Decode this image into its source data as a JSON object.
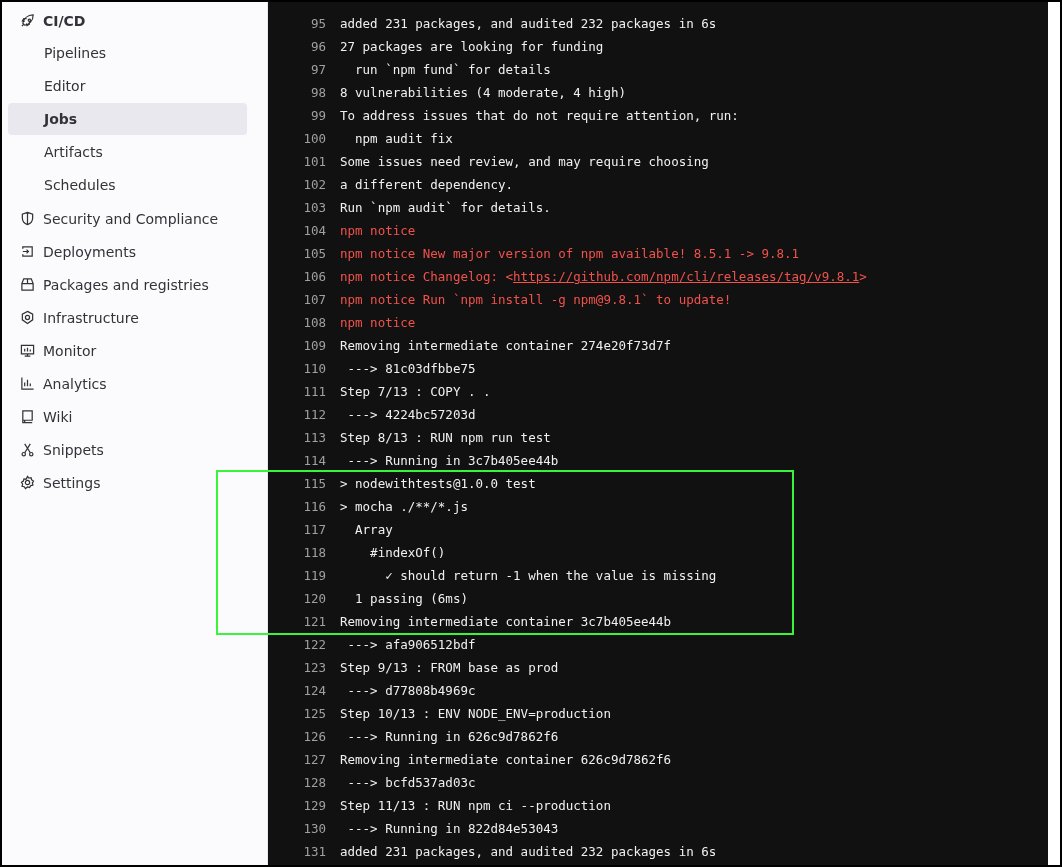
{
  "sidebar": {
    "section": {
      "label": "CI/CD",
      "children": [
        {
          "label": "Pipelines",
          "selected": false
        },
        {
          "label": "Editor",
          "selected": false
        },
        {
          "label": "Jobs",
          "selected": true
        },
        {
          "label": "Artifacts",
          "selected": false
        },
        {
          "label": "Schedules",
          "selected": false
        }
      ]
    },
    "items": [
      {
        "label": "Security and Compliance"
      },
      {
        "label": "Deployments"
      },
      {
        "label": "Packages and registries"
      },
      {
        "label": "Infrastructure"
      },
      {
        "label": "Monitor"
      },
      {
        "label": "Analytics"
      },
      {
        "label": "Wiki"
      },
      {
        "label": "Snippets"
      },
      {
        "label": "Settings"
      }
    ]
  },
  "log": {
    "lines": [
      {
        "number": "95",
        "kind": "normal",
        "text": "added 231 packages, and audited 232 packages in 6s"
      },
      {
        "number": "96",
        "kind": "normal",
        "text": "27 packages are looking for funding"
      },
      {
        "number": "97",
        "kind": "normal",
        "text": "  run `npm fund` for details"
      },
      {
        "number": "98",
        "kind": "normal",
        "text": "8 vulnerabilities (4 moderate, 4 high)"
      },
      {
        "number": "99",
        "kind": "normal",
        "text": "To address issues that do not require attention, run:"
      },
      {
        "number": "100",
        "kind": "normal",
        "text": "  npm audit fix"
      },
      {
        "number": "101",
        "kind": "normal",
        "text": "Some issues need review, and may require choosing"
      },
      {
        "number": "102",
        "kind": "normal",
        "text": "a different dependency."
      },
      {
        "number": "103",
        "kind": "normal",
        "text": "Run `npm audit` for details."
      },
      {
        "number": "104",
        "kind": "notice",
        "text": "npm notice"
      },
      {
        "number": "105",
        "kind": "notice",
        "text": "npm notice New major version of npm available! 8.5.1 -> 9.8.1"
      },
      {
        "number": "106",
        "kind": "notice",
        "text": "npm notice Changelog: <",
        "link": "https://github.com/npm/cli/releases/tag/v9.8.1",
        "suffix": ">"
      },
      {
        "number": "107",
        "kind": "notice",
        "text": "npm notice Run `npm install -g npm@9.8.1` to update!"
      },
      {
        "number": "108",
        "kind": "notice",
        "text": "npm notice"
      },
      {
        "number": "109",
        "kind": "normal",
        "text": "Removing intermediate container 274e20f73d7f"
      },
      {
        "number": "110",
        "kind": "normal",
        "text": " ---> 81c03dfbbe75"
      },
      {
        "number": "111",
        "kind": "normal",
        "text": "Step 7/13 : COPY . ."
      },
      {
        "number": "112",
        "kind": "normal",
        "text": " ---> 4224bc57203d"
      },
      {
        "number": "113",
        "kind": "normal",
        "text": "Step 8/13 : RUN npm run test"
      },
      {
        "number": "114",
        "kind": "normal",
        "text": " ---> Running in 3c7b405ee44b"
      },
      {
        "number": "115",
        "kind": "normal",
        "text": "> nodewithtests@1.0.0 test"
      },
      {
        "number": "116",
        "kind": "normal",
        "text": "> mocha ./**/*.js"
      },
      {
        "number": "117",
        "kind": "normal",
        "text": "  Array"
      },
      {
        "number": "118",
        "kind": "normal",
        "text": "    #indexOf()"
      },
      {
        "number": "119",
        "kind": "normal",
        "text": "      ✓ should return -1 when the value is missing"
      },
      {
        "number": "120",
        "kind": "normal",
        "text": "  1 passing (6ms)"
      },
      {
        "number": "121",
        "kind": "normal",
        "text": "Removing intermediate container 3c7b405ee44b"
      },
      {
        "number": "122",
        "kind": "normal",
        "text": " ---> afa906512bdf"
      },
      {
        "number": "123",
        "kind": "normal",
        "text": "Step 9/13 : FROM base as prod"
      },
      {
        "number": "124",
        "kind": "normal",
        "text": " ---> d77808b4969c"
      },
      {
        "number": "125",
        "kind": "normal",
        "text": "Step 10/13 : ENV NODE_ENV=production"
      },
      {
        "number": "126",
        "kind": "normal",
        "text": " ---> Running in 626c9d7862f6"
      },
      {
        "number": "127",
        "kind": "normal",
        "text": "Removing intermediate container 626c9d7862f6"
      },
      {
        "number": "128",
        "kind": "normal",
        "text": " ---> bcfd537ad03c"
      },
      {
        "number": "129",
        "kind": "normal",
        "text": "Step 11/13 : RUN npm ci --production"
      },
      {
        "number": "130",
        "kind": "normal",
        "text": " ---> Running in 822d84e53043"
      },
      {
        "number": "131",
        "kind": "normal",
        "text": "added 231 packages, and audited 232 packages in 6s"
      }
    ]
  }
}
